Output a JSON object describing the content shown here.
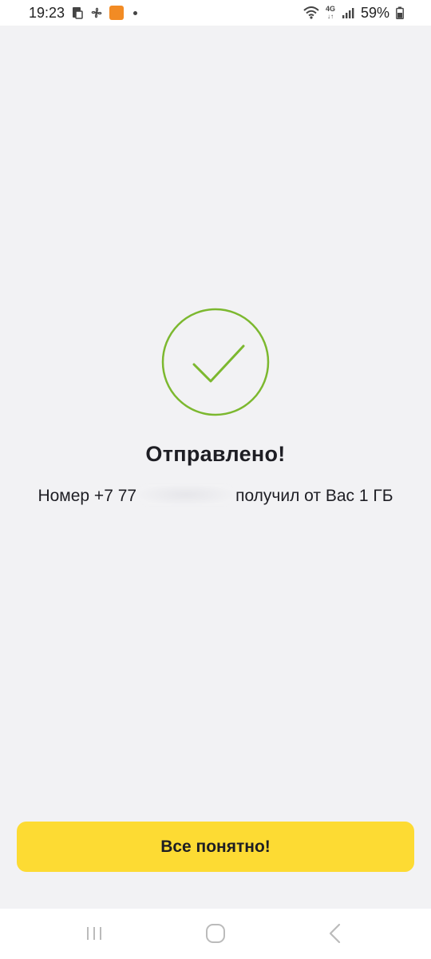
{
  "status_bar": {
    "time": "19:23",
    "battery": "59%",
    "network": "4G",
    "icons": [
      "tablet-icon",
      "fan-icon",
      "app-notification-icon",
      "dot-icon",
      "wifi-icon",
      "network-4g-icon",
      "signal-icon",
      "battery-icon"
    ]
  },
  "result": {
    "title": "Отправлено!",
    "message_prefix": "Номер +7 77",
    "message_suffix": "получил от Вас 1 ГБ",
    "icon": "checkmark-circle-icon"
  },
  "actions": {
    "confirm_label": "Все понятно!"
  },
  "nav_bar": {
    "icons": [
      "recent-apps-icon",
      "home-icon",
      "back-icon"
    ]
  },
  "colors": {
    "accent": "#fddb33",
    "success": "#7cb82f",
    "background": "#f2f2f4",
    "text": "#1e1e24"
  }
}
